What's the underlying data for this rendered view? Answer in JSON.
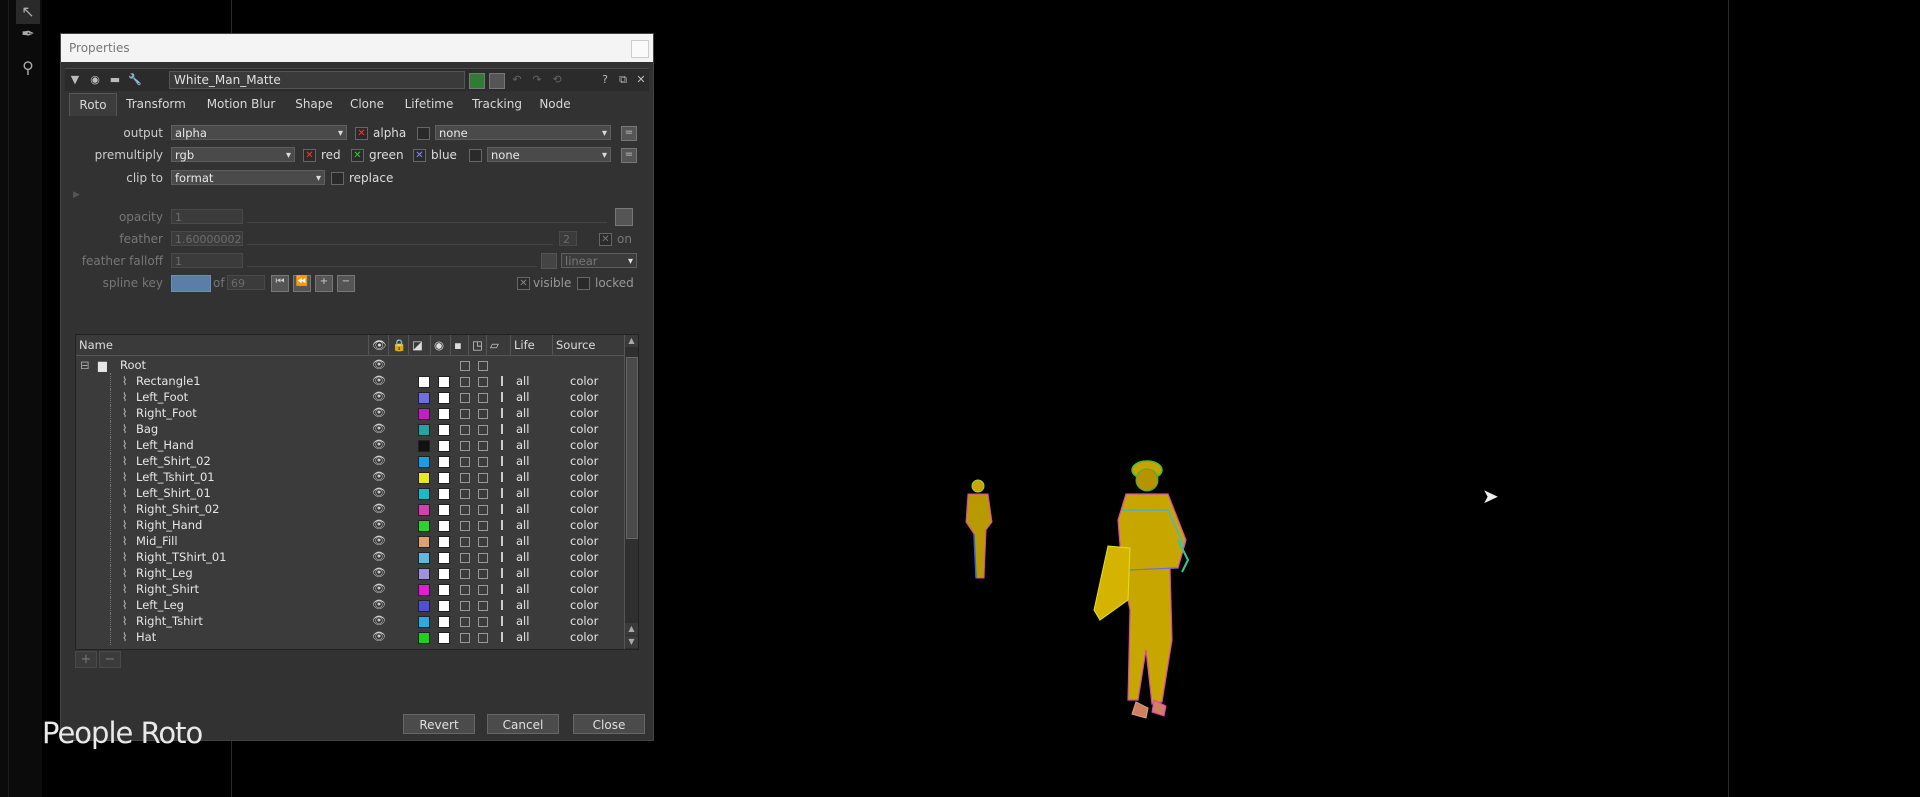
{
  "toolbar": {
    "tools": [
      "select-tool",
      "pen-tool",
      "brush-tool"
    ]
  },
  "window": {
    "title": "Properties"
  },
  "node": {
    "name": "White_Man_Matte"
  },
  "tabs": [
    "Roto",
    "Transform",
    "Motion Blur",
    "Shape",
    "Clone",
    "Lifetime",
    "Tracking",
    "Node"
  ],
  "params": {
    "output_label": "output",
    "output_value": "alpha",
    "output_alpha_label": "alpha",
    "output_none": "none",
    "premultiply_label": "premultiply",
    "premultiply_value": "rgb",
    "red_label": "red",
    "green_label": "green",
    "blue_label": "blue",
    "premultiply_none": "none",
    "clipto_label": "clip to",
    "clipto_value": "format",
    "replace_label": "replace",
    "opacity_label": "opacity",
    "opacity_value": "1",
    "feather_label": "feather",
    "feather_value": "1.60000002",
    "feather_channel": "2",
    "feather_on_label": "on",
    "falloff_label": "feather falloff",
    "falloff_value": "1",
    "falloff_mode": "linear",
    "splinekey_label": "spline key",
    "splinekey_of": "of",
    "splinekey_total": "69",
    "visible_label": "visible",
    "locked_label": "locked"
  },
  "table": {
    "headers": {
      "name": "Name",
      "life": "Life",
      "source": "Source"
    },
    "root": "Root",
    "rows": [
      {
        "name": "Rectangle1",
        "color": "#ffffff",
        "life": "all",
        "source": "color"
      },
      {
        "name": "Left_Foot",
        "color": "#6f6fe0",
        "life": "all",
        "source": "color"
      },
      {
        "name": "Right_Foot",
        "color": "#c020c0",
        "life": "all",
        "source": "color"
      },
      {
        "name": "Bag",
        "color": "#2aa0a0",
        "life": "all",
        "source": "color"
      },
      {
        "name": "Left_Hand",
        "color": "#111111",
        "life": "all",
        "source": "color"
      },
      {
        "name": "Left_Shirt_02",
        "color": "#1a9ee0",
        "life": "all",
        "source": "color"
      },
      {
        "name": "Left_Tshirt_01",
        "color": "#e8e820",
        "life": "all",
        "source": "color"
      },
      {
        "name": "Left_Shirt_01",
        "color": "#20b8c8",
        "life": "all",
        "source": "color"
      },
      {
        "name": "Right_Shirt_02",
        "color": "#d040b0",
        "life": "all",
        "source": "color"
      },
      {
        "name": "Right_Hand",
        "color": "#30d030",
        "life": "all",
        "source": "color"
      },
      {
        "name": "Mid_Fill",
        "color": "#e0a070",
        "life": "all",
        "source": "color"
      },
      {
        "name": "Right_TShirt_01",
        "color": "#60b8e0",
        "life": "all",
        "source": "color"
      },
      {
        "name": "Right_Leg",
        "color": "#a090e0",
        "life": "all",
        "source": "color"
      },
      {
        "name": "Right_Shirt",
        "color": "#e020d0",
        "life": "all",
        "source": "color"
      },
      {
        "name": "Left_Leg",
        "color": "#5050d0",
        "life": "all",
        "source": "color"
      },
      {
        "name": "Right_Tshirt",
        "color": "#30a8e0",
        "life": "all",
        "source": "color"
      },
      {
        "name": "Hat",
        "color": "#20d020",
        "life": "all",
        "source": "color"
      }
    ]
  },
  "buttons": {
    "revert": "Revert",
    "cancel": "Cancel",
    "close": "Close"
  },
  "overlay_title": "People Roto"
}
